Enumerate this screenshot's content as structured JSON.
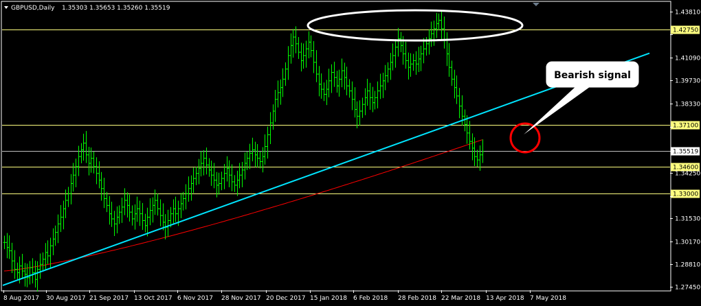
{
  "header": {
    "symbol": "GBPUSD,Daily",
    "ohlc": "1.35303 1.35653 1.35260 1.35519"
  },
  "callout": {
    "text": "Bearish signal"
  },
  "colors": {
    "background": "#000000",
    "candles": "#00ff00",
    "ma": "#ff0000",
    "trendline": "#00e5ff",
    "levels": "#ffff80",
    "price_line": "#c0c0c0",
    "axis": "#ffffff"
  },
  "chart_data": {
    "type": "bar",
    "title": "GBPUSD,Daily",
    "ylim": [
      1.2726,
      1.4438
    ],
    "y_ticks": [
      "1.43810",
      "1.42450",
      "1.41090",
      "1.39730",
      "1.38330",
      "1.36970",
      "1.35519",
      "1.34250",
      "1.32850",
      "1.31530",
      "1.30170",
      "1.28810",
      "1.27450"
    ],
    "x_ticks": [
      "8 Aug 2017",
      "30 Aug 2017",
      "21 Sep 2017",
      "13 Oct 2017",
      "6 Nov 2017",
      "28 Nov 2017",
      "20 Dec 2017",
      "15 Jan 2018",
      "6 Feb 2018",
      "28 Feb 2018",
      "22 Mar 2018",
      "13 Apr 2018",
      "7 May 2018"
    ],
    "horizontal_levels": [
      {
        "value": 1.4275,
        "label": "1.42750"
      },
      {
        "value": 1.371,
        "label": "1.37100"
      },
      {
        "value": 1.346,
        "label": "1.34600"
      },
      {
        "value": 1.33,
        "label": "1.33000"
      }
    ],
    "current_price": {
      "value": 1.35519,
      "label": "1.35519"
    },
    "series_close": [
      1.301,
      1.298,
      1.296,
      1.29,
      1.285,
      1.283,
      1.287,
      1.284,
      1.282,
      1.28,
      1.286,
      1.283,
      1.279,
      1.285,
      1.288,
      1.291,
      1.295,
      1.293,
      1.299,
      1.303,
      1.307,
      1.312,
      1.316,
      1.321,
      1.326,
      1.33,
      1.336,
      1.341,
      1.346,
      1.352,
      1.356,
      1.36,
      1.353,
      1.348,
      1.351,
      1.346,
      1.342,
      1.338,
      1.333,
      1.327,
      1.323,
      1.318,
      1.315,
      1.312,
      1.316,
      1.319,
      1.322,
      1.326,
      1.323,
      1.319,
      1.315,
      1.318,
      1.321,
      1.318,
      1.314,
      1.311,
      1.316,
      1.32,
      1.323,
      1.326,
      1.321,
      1.317,
      1.313,
      1.31,
      1.314,
      1.318,
      1.321,
      1.318,
      1.321,
      1.324,
      1.327,
      1.33,
      1.333,
      1.336,
      1.339,
      1.342,
      1.345,
      1.348,
      1.351,
      1.347,
      1.344,
      1.341,
      1.338,
      1.335,
      1.336,
      1.339,
      1.342,
      1.345,
      1.341,
      1.337,
      1.335,
      1.338,
      1.341,
      1.344,
      1.348,
      1.351,
      1.354,
      1.356,
      1.353,
      1.351,
      1.349,
      1.352,
      1.358,
      1.365,
      1.372,
      1.379,
      1.386,
      1.39,
      1.393,
      1.398,
      1.404,
      1.412,
      1.418,
      1.423,
      1.419,
      1.414,
      1.409,
      1.412,
      1.416,
      1.42,
      1.415,
      1.408,
      1.401,
      1.395,
      1.392,
      1.389,
      1.392,
      1.397,
      1.402,
      1.399,
      1.394,
      1.398,
      1.403,
      1.399,
      1.394,
      1.391,
      1.386,
      1.38,
      1.376,
      1.379,
      1.383,
      1.387,
      1.391,
      1.387,
      1.384,
      1.387,
      1.391,
      1.394,
      1.397,
      1.4,
      1.404,
      1.408,
      1.412,
      1.417,
      1.422,
      1.418,
      1.413,
      1.409,
      1.405,
      1.407,
      1.409,
      1.407,
      1.41,
      1.413,
      1.416,
      1.419,
      1.422,
      1.425,
      1.428,
      1.431,
      1.433,
      1.428,
      1.421,
      1.413,
      1.405,
      1.398,
      1.393,
      1.388,
      1.382,
      1.376,
      1.371,
      1.366,
      1.361,
      1.357,
      1.352,
      1.35,
      1.353,
      1.355
    ],
    "series_ma_start": 1.284,
    "series_ma_end": 1.362,
    "trendline": {
      "x_start_day": 0,
      "y_start": 1.2755,
      "x_end_day": 205,
      "y_end": 1.3875
    }
  }
}
